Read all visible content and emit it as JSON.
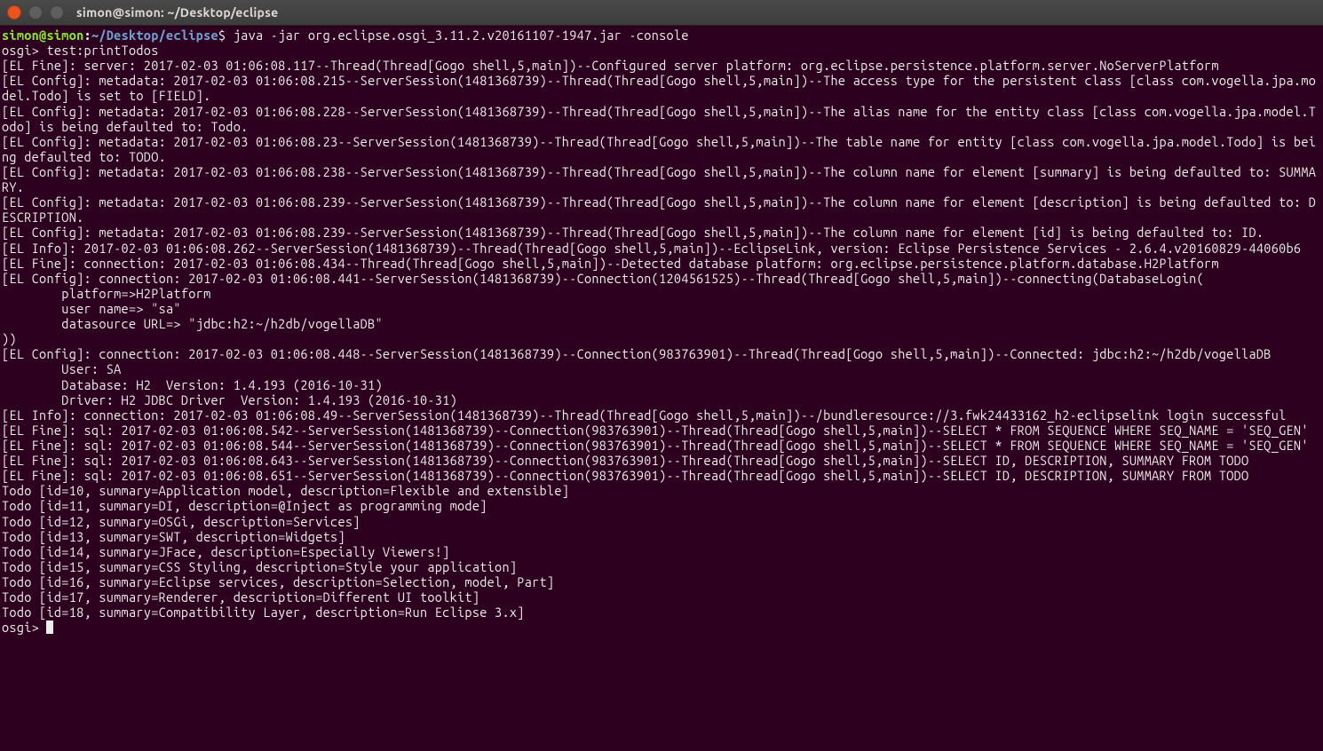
{
  "titlebar": {
    "title": "simon@simon: ~/Desktop/eclipse"
  },
  "prompt": {
    "userhost": "simon@simon",
    "sep": ":",
    "path": "~/Desktop/eclipse",
    "dollar": "$ ",
    "command": "java -jar org.eclipse.osgi_3.11.2.v20161107-1947.jar -console"
  },
  "lines": {
    "l1": "osgi> test:printTodos",
    "l2": "[EL Fine]: server: 2017-02-03 01:06:08.117--Thread(Thread[Gogo shell,5,main])--Configured server platform: org.eclipse.persistence.platform.server.NoServerPlatform",
    "l3": "[EL Config]: metadata: 2017-02-03 01:06:08.215--ServerSession(1481368739)--Thread(Thread[Gogo shell,5,main])--The access type for the persistent class [class com.vogella.jpa.model.Todo] is set to [FIELD].",
    "l4": "[EL Config]: metadata: 2017-02-03 01:06:08.228--ServerSession(1481368739)--Thread(Thread[Gogo shell,5,main])--The alias name for the entity class [class com.vogella.jpa.model.Todo] is being defaulted to: Todo.",
    "l5": "[EL Config]: metadata: 2017-02-03 01:06:08.23--ServerSession(1481368739)--Thread(Thread[Gogo shell,5,main])--The table name for entity [class com.vogella.jpa.model.Todo] is being defaulted to: TODO.",
    "l6": "[EL Config]: metadata: 2017-02-03 01:06:08.238--ServerSession(1481368739)--Thread(Thread[Gogo shell,5,main])--The column name for element [summary] is being defaulted to: SUMMARY.",
    "l7": "[EL Config]: metadata: 2017-02-03 01:06:08.239--ServerSession(1481368739)--Thread(Thread[Gogo shell,5,main])--The column name for element [description] is being defaulted to: DESCRIPTION.",
    "l8": "[EL Config]: metadata: 2017-02-03 01:06:08.239--ServerSession(1481368739)--Thread(Thread[Gogo shell,5,main])--The column name for element [id] is being defaulted to: ID.",
    "l9": "[EL Info]: 2017-02-03 01:06:08.262--ServerSession(1481368739)--Thread(Thread[Gogo shell,5,main])--EclipseLink, version: Eclipse Persistence Services - 2.6.4.v20160829-44060b6",
    "l10": "[EL Fine]: connection: 2017-02-03 01:06:08.434--Thread(Thread[Gogo shell,5,main])--Detected database platform: org.eclipse.persistence.platform.database.H2Platform",
    "l11": "[EL Config]: connection: 2017-02-03 01:06:08.441--ServerSession(1481368739)--Connection(1204561525)--Thread(Thread[Gogo shell,5,main])--connecting(DatabaseLogin(",
    "l12": "        platform=>H2Platform",
    "l13": "        user name=> \"sa\"",
    "l14": "        datasource URL=> \"jdbc:h2:~/h2db/vogellaDB\"",
    "l15": "))",
    "l16": "[EL Config]: connection: 2017-02-03 01:06:08.448--ServerSession(1481368739)--Connection(983763901)--Thread(Thread[Gogo shell,5,main])--Connected: jdbc:h2:~/h2db/vogellaDB",
    "l17": "        User: SA",
    "l18": "        Database: H2  Version: 1.4.193 (2016-10-31)",
    "l19": "        Driver: H2 JDBC Driver  Version: 1.4.193 (2016-10-31)",
    "l20": "[EL Info]: connection: 2017-02-03 01:06:08.49--ServerSession(1481368739)--Thread(Thread[Gogo shell,5,main])--/bundleresource://3.fwk24433162_h2-eclipselink login successful",
    "l21": "[EL Fine]: sql: 2017-02-03 01:06:08.542--ServerSession(1481368739)--Connection(983763901)--Thread(Thread[Gogo shell,5,main])--SELECT * FROM SEQUENCE WHERE SEQ_NAME = 'SEQ_GEN'",
    "l22": "[EL Fine]: sql: 2017-02-03 01:06:08.544--ServerSession(1481368739)--Connection(983763901)--Thread(Thread[Gogo shell,5,main])--SELECT * FROM SEQUENCE WHERE SEQ_NAME = 'SEQ_GEN'",
    "l23": "[EL Fine]: sql: 2017-02-03 01:06:08.643--ServerSession(1481368739)--Connection(983763901)--Thread(Thread[Gogo shell,5,main])--SELECT ID, DESCRIPTION, SUMMARY FROM TODO",
    "l24": "[EL Fine]: sql: 2017-02-03 01:06:08.651--ServerSession(1481368739)--Connection(983763901)--Thread(Thread[Gogo shell,5,main])--SELECT ID, DESCRIPTION, SUMMARY FROM TODO",
    "l25": "Todo [id=10, summary=Application model, description=Flexible and extensible]",
    "l26": "Todo [id=11, summary=DI, description=@Inject as programming mode]",
    "l27": "Todo [id=12, summary=OSGi, description=Services]",
    "l28": "Todo [id=13, summary=SWT, description=Widgets]",
    "l29": "Todo [id=14, summary=JFace, description=Especially Viewers!]",
    "l30": "Todo [id=15, summary=CSS Styling, description=Style your application]",
    "l31": "Todo [id=16, summary=Eclipse services, description=Selection, model, Part]",
    "l32": "Todo [id=17, summary=Renderer, description=Different UI toolkit]",
    "l33": "Todo [id=18, summary=Compatibility Layer, description=Run Eclipse 3.x]",
    "l34": "osgi> "
  }
}
